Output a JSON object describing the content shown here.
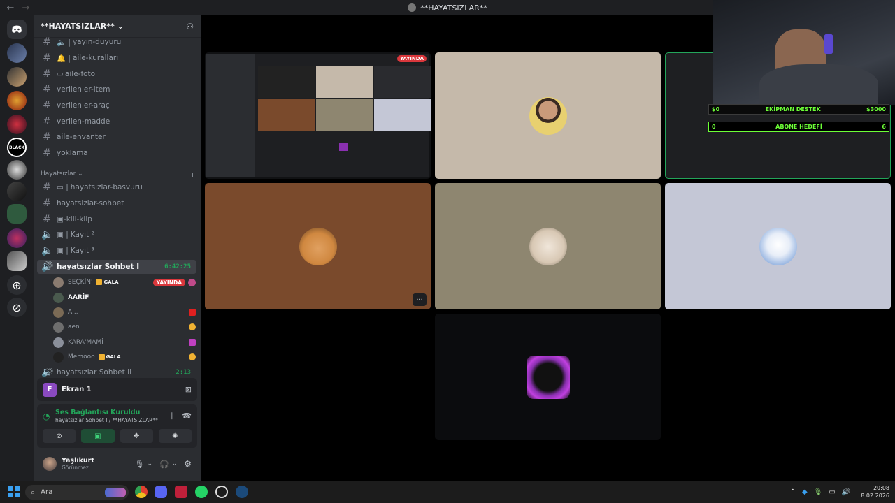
{
  "window": {
    "title": "**HAYATSIZLAR**",
    "back": "←",
    "forward": "→"
  },
  "guild": {
    "name": "**HAYATSIZLAR**"
  },
  "channels": [
    {
      "name": "yayın-duyuru",
      "prefix": "🔈 |",
      "type": "text"
    },
    {
      "name": "aile-kuralları",
      "prefix": "🔔 |",
      "type": "text"
    },
    {
      "name": "aile-foto",
      "prefix": "▭",
      "type": "text"
    },
    {
      "name": "verilenler-item",
      "prefix": "",
      "type": "text"
    },
    {
      "name": "verilenler-araç",
      "prefix": "",
      "type": "text"
    },
    {
      "name": "verilen-madde",
      "prefix": "",
      "type": "text"
    },
    {
      "name": "aile-envanter",
      "prefix": "",
      "type": "text"
    },
    {
      "name": "yoklama",
      "prefix": "",
      "type": "text"
    }
  ],
  "category": {
    "name": "Hayatsızlar",
    "add": "+"
  },
  "channels2": [
    {
      "name": "hayatsizlar-basvuru",
      "prefix": "▭ |",
      "type": "text"
    },
    {
      "name": "hayatsizlar-sohbet",
      "prefix": "",
      "type": "text"
    },
    {
      "name": "-kill-klip",
      "prefix": "▣",
      "type": "text"
    },
    {
      "name": "Kayıt ²",
      "prefix": "▣ |",
      "type": "voice"
    },
    {
      "name": "Kayıt ³",
      "prefix": "▣ |",
      "type": "voice"
    }
  ],
  "active_voice": {
    "name": "hayatsızlar Sohbet I",
    "timer": "6:42:25"
  },
  "voice_users": [
    {
      "name": "SEÇKİN'",
      "badge": "GALA",
      "live": "YAYINDA",
      "color": "#8a7b70"
    },
    {
      "name": "AARİF",
      "color": "#4a5a4e"
    },
    {
      "name": "A...",
      "color": "#7a6a55"
    },
    {
      "name": "aen",
      "color": "#6e6e6e"
    },
    {
      "name": "KARA'MAMİ",
      "color": "#8a8f9a"
    },
    {
      "name": "Memooo",
      "badge": "GALA",
      "color": "#222222"
    }
  ],
  "next_voice": {
    "name": "hayatsızlar Sohbet II",
    "timer": "2:13"
  },
  "stream_panel": {
    "title": "Ekran 1",
    "icon_letter": "F"
  },
  "connection": {
    "status": "Ses Bağlantısı Kuruldu",
    "detail": "hayatsızlar Sohbet I / **HAYATSIZLAR**"
  },
  "user": {
    "name": "Yaşlıkurt",
    "status": "Görünmez"
  },
  "stage": {
    "live_label": "YAYINDA",
    "more": "···",
    "overlay": [
      {
        "left": "$0",
        "label": "EKİPMAN DESTEK",
        "right": "$3000"
      },
      {
        "left": "0",
        "label": "ABONE HEDEFİ",
        "right": "6"
      }
    ]
  },
  "taskbar": {
    "search_placeholder": "Ara",
    "time": "20:08",
    "date": "8.02.2026"
  },
  "colors": {
    "accent_green": "#23a55a",
    "live_red": "#da373c",
    "overlay_green": "#6cff36"
  }
}
